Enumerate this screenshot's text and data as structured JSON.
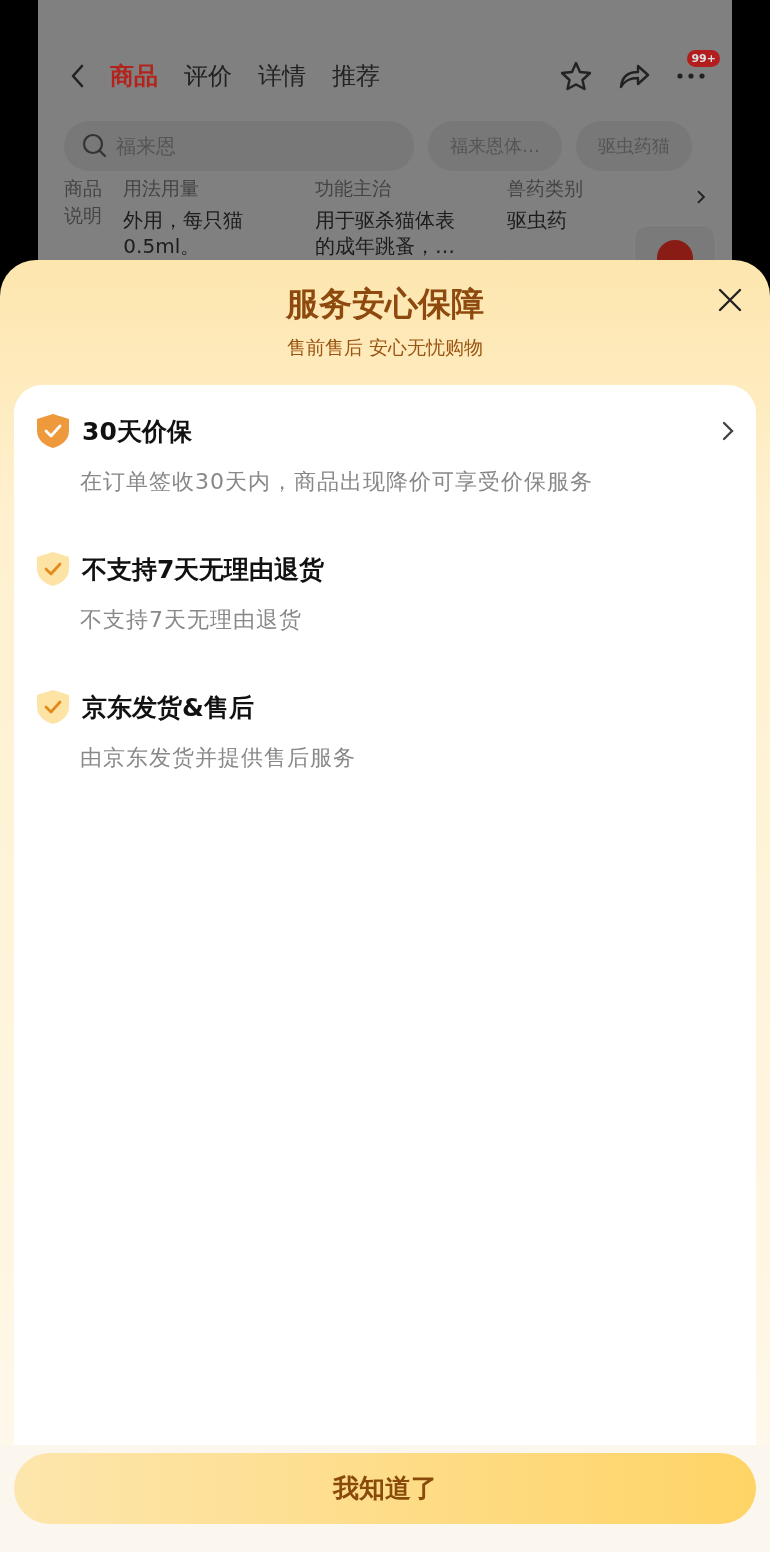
{
  "nav": {
    "tabs": [
      {
        "label": "商品",
        "selected": true
      },
      {
        "label": "评价",
        "selected": false
      },
      {
        "label": "详情",
        "selected": false
      },
      {
        "label": "推荐",
        "selected": false
      }
    ],
    "badge": "99+"
  },
  "search": {
    "value": "福来恩",
    "chips": [
      "福来恩体…",
      "驱虫药猫"
    ]
  },
  "spec": {
    "label": "商品说明",
    "columns": [
      {
        "heading": "用法用量",
        "lines": [
          "外用，每只猫",
          "0.5ml。"
        ]
      },
      {
        "heading": "功能主治",
        "lines": [
          "用于驱杀猫体表",
          "的成年跳蚤，…"
        ]
      },
      {
        "heading": "兽药类别",
        "lines": [
          "驱虫药"
        ]
      }
    ]
  },
  "sheet": {
    "title": "服务安心保障",
    "subtitle": "售前售后 安心无忧购物",
    "items": [
      {
        "kind": "link",
        "title": "30天价保",
        "description": "在订单签收30天内，商品出现降价可享受价保服务"
      },
      {
        "kind": "plain",
        "title": "不支持7天无理由退货",
        "description": "不支持7天无理由退货"
      },
      {
        "kind": "plain",
        "title": "京东发货&售后",
        "description": "由京东发货并提供售后服务"
      }
    ],
    "button": "我知道了"
  }
}
